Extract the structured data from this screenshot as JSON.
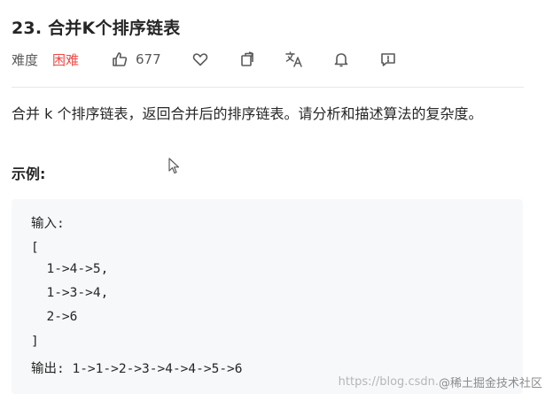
{
  "problem": {
    "title": "23. 合并K个排序链表",
    "difficulty_label": "难度",
    "difficulty_value": "困难",
    "likes": "677"
  },
  "toolbar_icons": [
    "thumbs-up-icon",
    "heart-icon",
    "share-icon",
    "translate-icon",
    "bell-icon",
    "feedback-icon"
  ],
  "description": "合并 k 个排序链表，返回合并后的排序链表。请分析和描述算法的复杂度。",
  "example": {
    "heading": "示例:",
    "lines": [
      "输入:",
      "[",
      "  1->4->5,",
      "  1->3->4,",
      "  2->6",
      "]",
      "输出: 1->1->2->3->4->4->5->6"
    ]
  },
  "watermark": {
    "url": "https://blog.csdn.",
    "brand": "@稀土掘金技术社区"
  },
  "colors": {
    "difficulty_hard": "#ef4743",
    "code_background": "#f7f8fa"
  }
}
